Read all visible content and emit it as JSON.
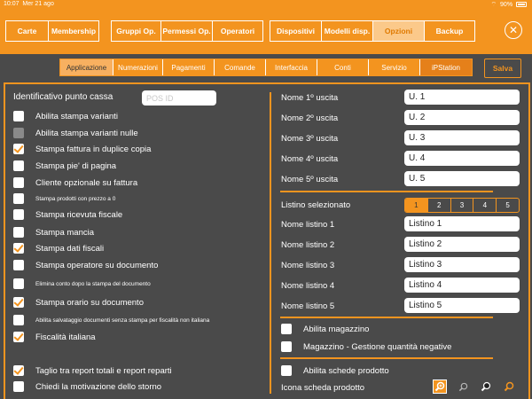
{
  "status_bar": {
    "time": "10:07",
    "date": "Mer 21 ago",
    "battery": "90%"
  },
  "top_tabs": {
    "group1": [
      "Carte",
      "Membership"
    ],
    "group2": [
      "Gruppi Op.",
      "Permessi Op.",
      "Operatori"
    ],
    "group3": [
      "Dispositivi",
      "Modelli disp.",
      "Opzioni",
      "Backup"
    ],
    "active": "Opzioni"
  },
  "sub_tabs": {
    "items": [
      "Applicazione",
      "Numerazioni",
      "Pagamenti",
      "Comande",
      "Interfaccia",
      "Conti",
      "Servizio",
      "iPStation"
    ],
    "active": "Applicazione",
    "save_label": "Salva"
  },
  "left": {
    "pos_label": "Identificativo punto cassa",
    "pos_placeholder": "POS ID",
    "options": [
      {
        "label": "Abilita stampa varianti",
        "checked": false
      },
      {
        "label": "Abilita stampa varianti nulle",
        "checked": false,
        "disabled": true
      },
      {
        "label": "Stampa fattura in duplice copia",
        "checked": true
      },
      {
        "label": "Stampa pie' di pagina",
        "checked": false
      },
      {
        "label": "Cliente opzionale su fattura",
        "checked": false
      },
      {
        "label": "Stampa prodotti con prezzo a 0",
        "checked": false,
        "small": true
      },
      {
        "label": "Stampa ricevuta fiscale",
        "checked": false
      },
      {
        "label": "Stampa mancia",
        "checked": false
      },
      {
        "label": "Stampa dati fiscali",
        "checked": true
      },
      {
        "label": "Stampa operatore su documento",
        "checked": false
      },
      {
        "label": "Elimina conto dopo la stampa del documento",
        "checked": false,
        "small": true
      },
      {
        "label": "Stampa orario su documento",
        "checked": true
      },
      {
        "label": "Abilita salvataggio documenti senza stampa per fiscalità non italiana",
        "checked": false,
        "small": true
      },
      {
        "label": "Fiscalità italiana",
        "checked": true
      },
      {
        "label": "Taglio tra report totali e report reparti",
        "checked": true
      },
      {
        "label": "Chiedi la motivazione dello storno",
        "checked": false
      }
    ]
  },
  "right": {
    "outputs": [
      {
        "label": "Nome 1º uscita",
        "value": "U. 1"
      },
      {
        "label": "Nome 2º uscita",
        "value": "U. 2"
      },
      {
        "label": "Nome 3º uscita",
        "value": "U. 3"
      },
      {
        "label": "Nome 4º uscita",
        "value": "U. 4"
      },
      {
        "label": "Nome 5º uscita",
        "value": "U. 5"
      }
    ],
    "listino_label": "Listino selezionato",
    "listino_options": [
      "1",
      "2",
      "3",
      "4",
      "5"
    ],
    "listino_selected": "1",
    "listini": [
      {
        "label": "Nome listino 1",
        "value": "Listino 1"
      },
      {
        "label": "Nome listino 2",
        "value": "Listino 2"
      },
      {
        "label": "Nome listino 3",
        "value": "Listino 3"
      },
      {
        "label": "Nome listino 4",
        "value": "Listino 4"
      },
      {
        "label": "Nome listino 5",
        "value": "Listino 5"
      }
    ],
    "magazzino": [
      {
        "label": "Abilita magazzino",
        "checked": false
      },
      {
        "label": "Magazzino - Gestione quantità negative",
        "checked": false
      }
    ],
    "schede": {
      "label": "Abilita schede prodotto",
      "checked": false
    },
    "icon_label": "Icona scheda prodotto",
    "icons": [
      "zoom-in-icon",
      "zoom-in-small-icon",
      "zoom-in-dark-icon",
      "zoom-in-orange-icon"
    ]
  },
  "colors": {
    "accent": "#f3941f",
    "background": "#4a4a4a"
  }
}
